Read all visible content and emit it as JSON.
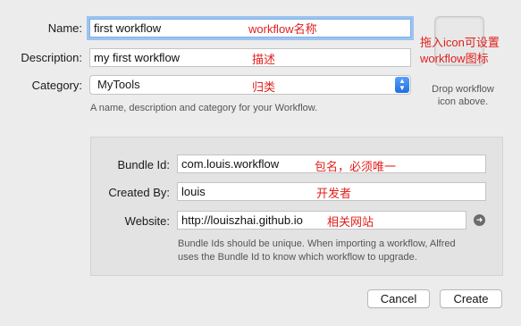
{
  "workflow": {
    "name_label": "Name:",
    "name_value": "first workflow",
    "name_note": "workflow名称",
    "description_label": "Description:",
    "description_value": "my first workflow",
    "description_note": "描述",
    "category_label": "Category:",
    "category_value": "MyTools",
    "category_note": "归类",
    "hint": "A name, description and category for your Workflow."
  },
  "icon_well": {
    "note_line1": "拖入icon可设置",
    "note_line2": "workflow图标",
    "drop_line1": "Drop workflow",
    "drop_line2": "icon above."
  },
  "bundle": {
    "bundle_id_label": "Bundle Id:",
    "bundle_id_value": "com.louis.workflow",
    "bundle_id_note": "包名，必须唯一",
    "created_by_label": "Created By:",
    "created_by_value": "louis",
    "created_by_note": "开发者",
    "website_label": "Website:",
    "website_value": "http://louiszhai.github.io",
    "website_note": "相关网站",
    "website_icon": "arrow-right-circle-icon",
    "hint_line1": "Bundle Ids should be unique. When importing a workflow, Alfred",
    "hint_line2": "uses the Bundle Id to know which workflow to upgrade."
  },
  "buttons": {
    "cancel": "Cancel",
    "create": "Create"
  },
  "colors": {
    "annotation": "#e0201c",
    "focus_ring": "#9cc3f0",
    "accent": "#1e6fe0"
  }
}
